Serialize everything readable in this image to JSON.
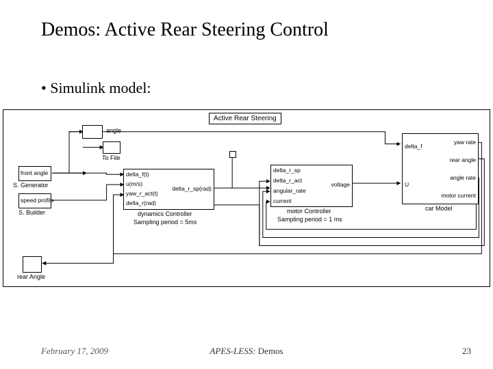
{
  "title": "Demos: Active Rear Steering Control",
  "bullet": "Simulink model:",
  "footer": {
    "date": "February 17, 2009",
    "center_prefix": "APES-LESS:",
    "center_suffix": " Demos",
    "page": "23"
  },
  "diagram": {
    "title_label": "Active Rear Steering",
    "blocks": {
      "to_file": {
        "name": "To File"
      },
      "front_angle": {
        "name": "front angle",
        "type": "S. Generator"
      },
      "speed_profile": {
        "name": "speed profile",
        "type": "S. Builder"
      },
      "rear_angle_out": {
        "name": "rear Angle"
      },
      "dynamics": {
        "name": "dynamics Controller",
        "sample": "Sampling period = 5ms",
        "ports_in": [
          "delta_f(t)",
          "u(m/s)",
          "yaw_r_act(t)",
          "delta_r(rad)"
        ],
        "port_out": "delta_r_sp(rad)"
      },
      "motor": {
        "name": "motor Controller",
        "sample": "Sampling period = 1 ms",
        "ports_in": [
          "delta_r_sp",
          "delta_r_act",
          "angular_rate",
          "current"
        ],
        "port_out": "voltage"
      },
      "car": {
        "name": "car Model",
        "ports_in": [
          "delta_f",
          "U"
        ],
        "ports_out": [
          "yaw rate",
          "rear angle",
          "angle rate",
          "motor current"
        ]
      },
      "angle_disp": {
        "label": "angle"
      }
    }
  }
}
